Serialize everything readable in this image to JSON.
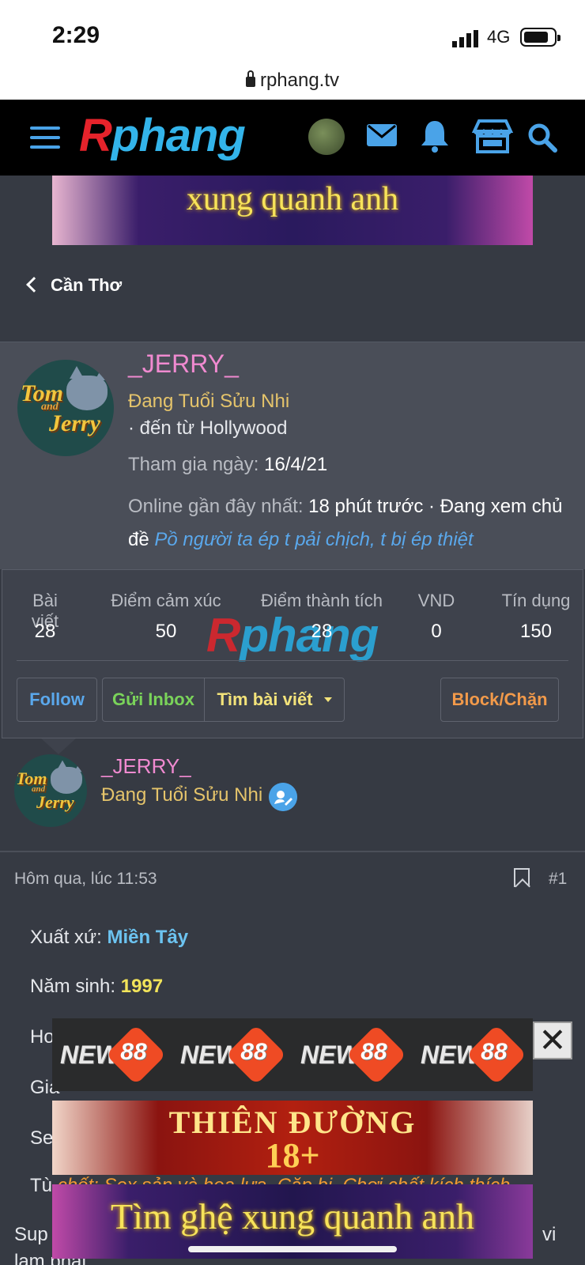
{
  "status": {
    "time": "2:29",
    "network": "4G"
  },
  "browser": {
    "url": "rphang.tv"
  },
  "nav": {
    "logo_r": "R",
    "logo_rest": "phang"
  },
  "banner_top": {
    "text": "xung quanh anh"
  },
  "breadcrumb": {
    "label": "Cần Thơ"
  },
  "profile": {
    "username": "_JERRY_",
    "title": "Đang Tuổi Sửu Nhi",
    "from": "· đến từ Hollywood",
    "join_label": "Tham gia ngày:",
    "join_value": "16/4/21",
    "online_label": "Online gần đây nhất:",
    "online_value": "18 phút trước · Đang xem chủ đề",
    "online_thread": "Pồ người ta ép t pải chịch, t bị ép thiệt"
  },
  "stats": [
    {
      "label": "Bài viết",
      "value": "28"
    },
    {
      "label": "Điểm cảm xúc",
      "value": "50"
    },
    {
      "label": "Điểm thành tích",
      "value": "28"
    },
    {
      "label": "VND",
      "value": "0"
    },
    {
      "label": "Tín dụng",
      "value": "150"
    }
  ],
  "actions": {
    "follow": "Follow",
    "inbox": "Gửi Inbox",
    "find_posts": "Tìm bài viết",
    "block": "Block/Chặn"
  },
  "post": {
    "username": "_JERRY_",
    "user_title": "Đang Tuổi Sửu Nhi",
    "date": "Hôm qua, lúc 11:53",
    "number": "#1",
    "lines": {
      "origin_label": "Xuất xứ:",
      "origin_value": "Miền Tây",
      "birth_label": "Năm sinh:",
      "birth_value": "1997",
      "l3": "Ho",
      "l4": "Gia",
      "l5": "Se",
      "l6_label": "Tù",
      "l6_value": "chốt: Sex sản và hoa lưa. Cặp bị. Chơi chất kích thích",
      "l7": "Sup",
      "l7_tail": "vi",
      "l8": "lam phat"
    }
  },
  "ads": {
    "new88": "NEW88",
    "new88_num": "88",
    "new88_prefix": "NEW",
    "close": "✕",
    "thien_line1": "THIÊN ĐƯỜNG",
    "thien_line2": "18+",
    "tim": "Tìm ghệ xung quanh anh"
  },
  "colors": {
    "accent": "#4aa3e8",
    "username": "#f08ad0",
    "title": "#e5c46b",
    "bg": "#363a43"
  }
}
